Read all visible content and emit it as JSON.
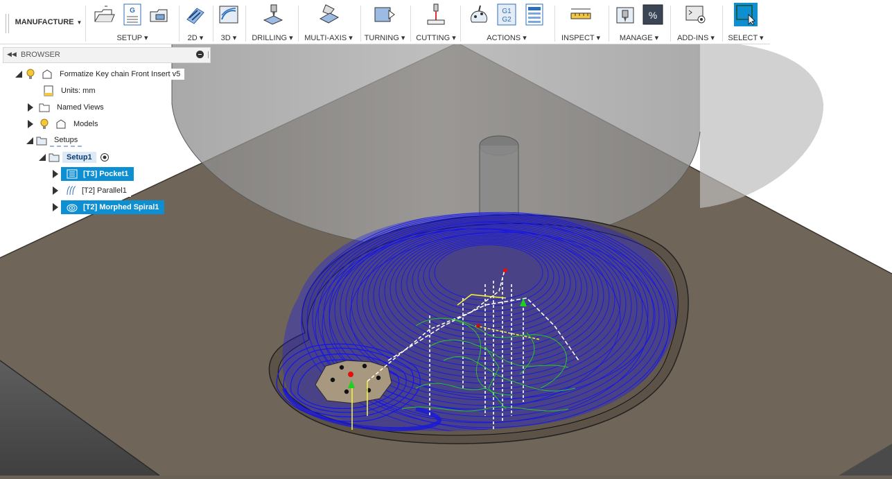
{
  "toolbar": {
    "workspace": "MANUFACTURE",
    "groups": [
      {
        "label": "SETUP",
        "icons": [
          "new-setup-icon",
          "nc-program-icon",
          "stock-setup-icon"
        ]
      },
      {
        "label": "2D",
        "icons": [
          "2d-pocket-icon"
        ]
      },
      {
        "label": "3D",
        "icons": [
          "3d-adaptive-icon"
        ]
      },
      {
        "label": "DRILLING",
        "icons": [
          "drill-icon"
        ]
      },
      {
        "label": "MULTI-AXIS",
        "icons": [
          "multi-axis-icon"
        ]
      },
      {
        "label": "TURNING",
        "icons": [
          "turning-icon"
        ]
      },
      {
        "label": "CUTTING",
        "icons": [
          "cutting-icon"
        ]
      },
      {
        "label": "ACTIONS",
        "icons": [
          "simulate-icon",
          "post-process-icon",
          "setup-sheet-icon"
        ]
      },
      {
        "label": "INSPECT",
        "icons": [
          "measure-icon"
        ]
      },
      {
        "label": "MANAGE",
        "icons": [
          "tool-library-icon",
          "template-icon"
        ]
      },
      {
        "label": "ADD-INS",
        "icons": [
          "scripts-icon"
        ]
      },
      {
        "label": "SELECT",
        "icons": [
          "select-icon"
        ]
      }
    ],
    "g_letter": "G",
    "g1g2_top": "G1",
    "g1g2_bottom": "G2",
    "percent_glyph": "%"
  },
  "browser": {
    "title": "BROWSER",
    "document": "Formatize Key chain Front Insert v5",
    "units": "Units: mm",
    "named_views": "Named Views",
    "models": "Models",
    "setups": "Setups",
    "setup1": "Setup1",
    "operations": [
      {
        "label": "[T3] Pocket1",
        "selected": true
      },
      {
        "label": "[T2] Parallel1",
        "selected": false
      },
      {
        "label": "[T2] Morphed Spiral1",
        "selected": true
      }
    ]
  },
  "colors": {
    "toolpath": "#1010e8",
    "rapid": "#f0f040",
    "lead": "#30c030",
    "selection": "#0d8fd2",
    "stock": "#6b6257"
  }
}
